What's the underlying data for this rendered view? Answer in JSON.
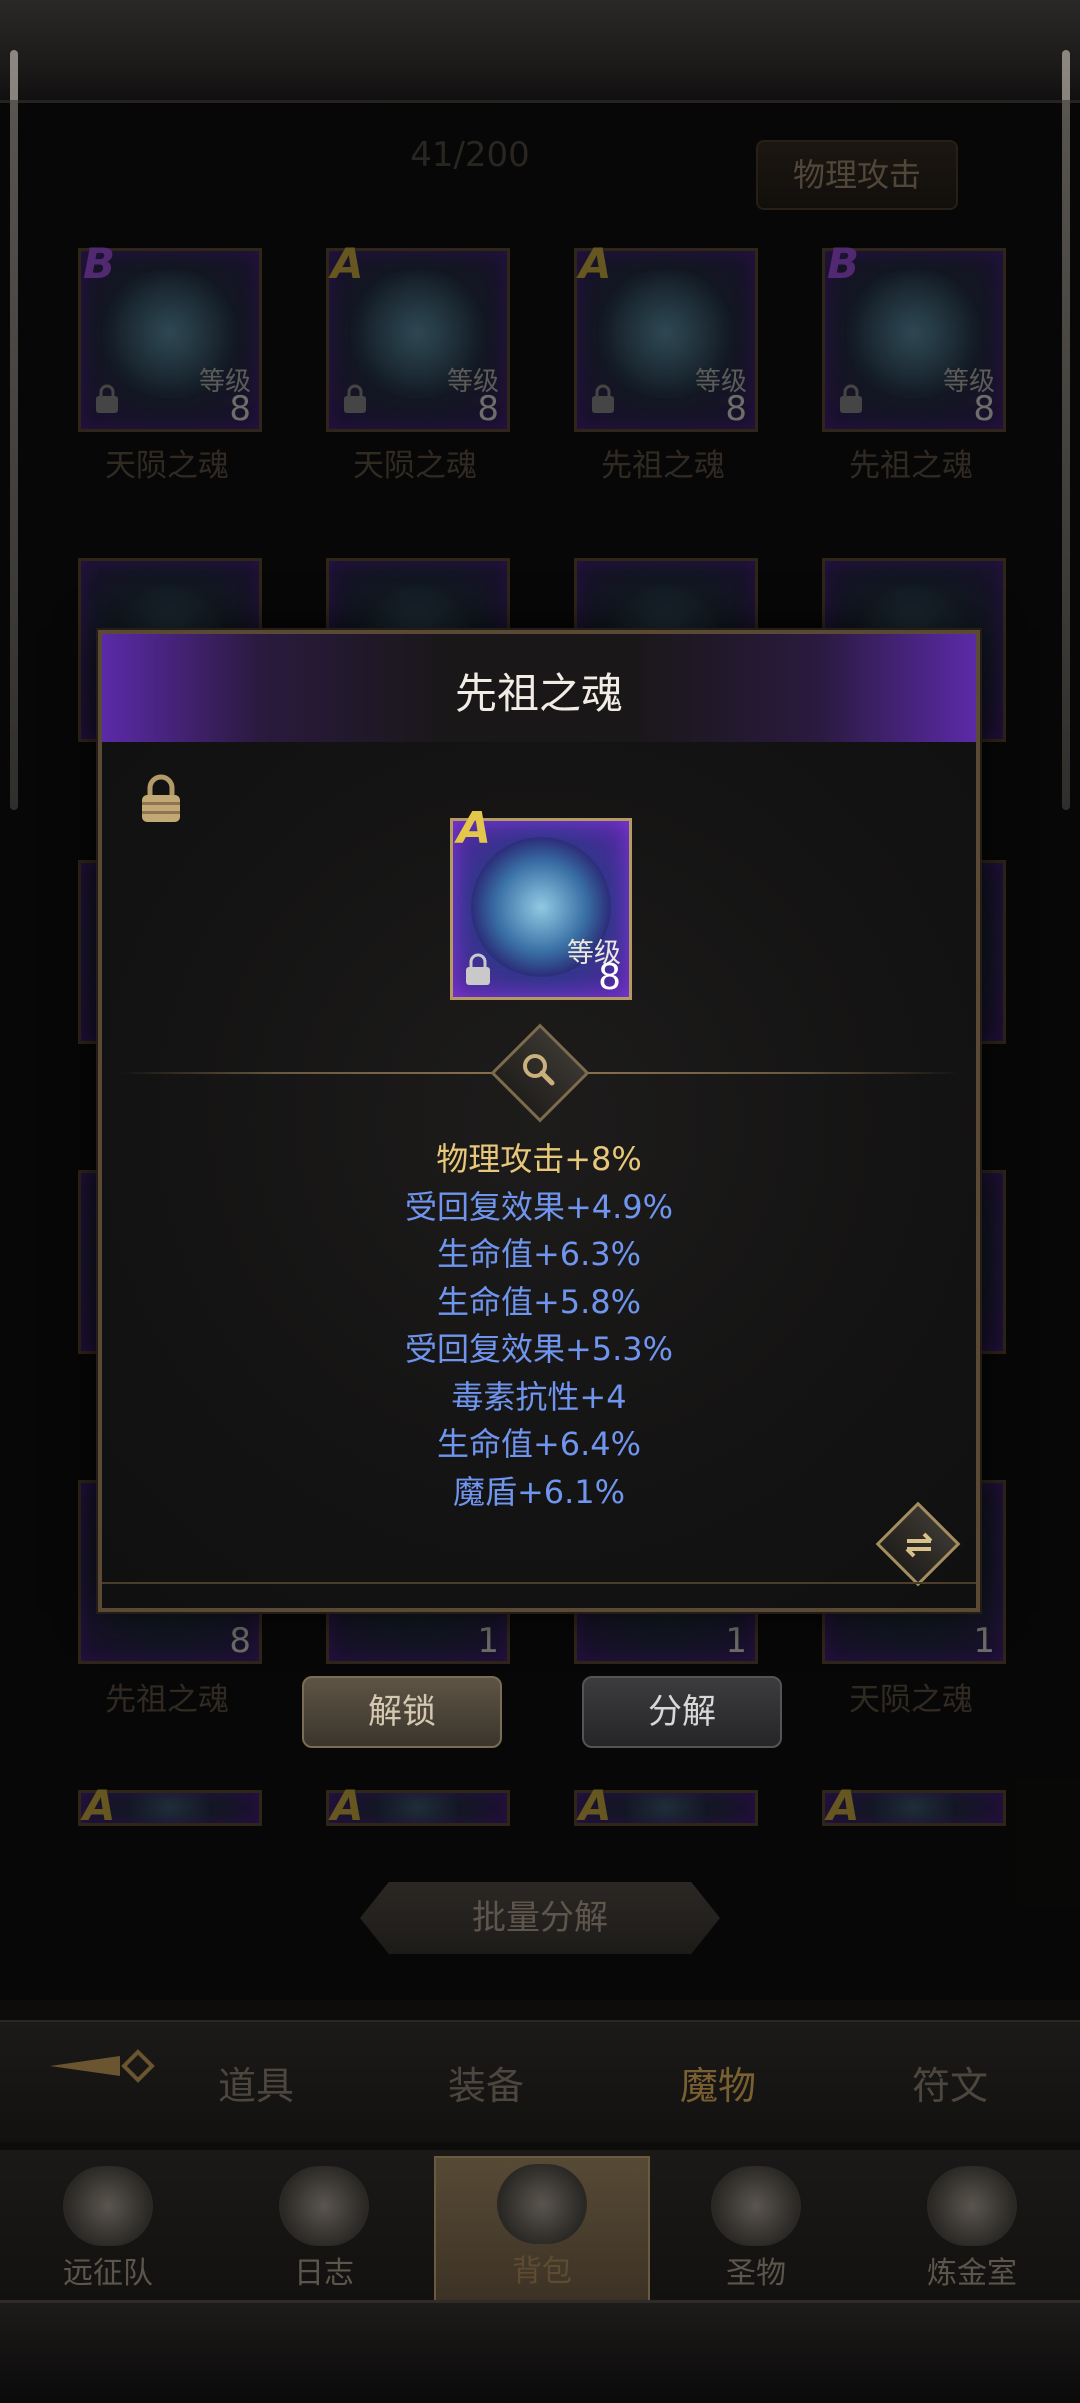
{
  "header": {
    "count": "41/200",
    "filter_label": "物理攻击"
  },
  "grid": {
    "row1": [
      {
        "rank": "B",
        "level_label": "等级",
        "level": "8",
        "name": "天陨之魂"
      },
      {
        "rank": "A",
        "level_label": "等级",
        "level": "8",
        "name": "天陨之魂"
      },
      {
        "rank": "A",
        "level_label": "等级",
        "level": "8",
        "name": "先祖之魂"
      },
      {
        "rank": "B",
        "level_label": "等级",
        "level": "8",
        "name": "先祖之魂"
      }
    ],
    "row5": [
      {
        "level": "8",
        "name": "先祖之魂"
      },
      {
        "level": "1",
        "name": ""
      },
      {
        "level": "1",
        "name": ""
      },
      {
        "level": "1",
        "name": "天陨之魂"
      }
    ],
    "row6_ranks": [
      "A",
      "A",
      "A",
      "A"
    ]
  },
  "modal": {
    "title": "先祖之魂",
    "card": {
      "rank": "A",
      "level_label": "等级",
      "level": "8"
    },
    "stats": [
      {
        "text": "物理攻击+8%",
        "color": "#e7c77a"
      },
      {
        "text": "受回复效果+4.9%",
        "color": "#6f95ee"
      },
      {
        "text": "生命值+6.3%",
        "color": "#6f95ee"
      },
      {
        "text": "生命值+5.8%",
        "color": "#6f95ee"
      },
      {
        "text": "受回复效果+5.3%",
        "color": "#6f95ee"
      },
      {
        "text": "毒素抗性+4",
        "color": "#6f95ee"
      },
      {
        "text": "生命值+6.4%",
        "color": "#6f95ee"
      },
      {
        "text": "魔盾+6.1%",
        "color": "#6f95ee"
      }
    ]
  },
  "actions": {
    "unlock": "解锁",
    "decompose": "分解",
    "batch_decompose": "批量分解"
  },
  "tabs": [
    "道具",
    "装备",
    "魔物",
    "符文"
  ],
  "nav": [
    "远征队",
    "日志",
    "背包",
    "圣物",
    "炼金室"
  ]
}
